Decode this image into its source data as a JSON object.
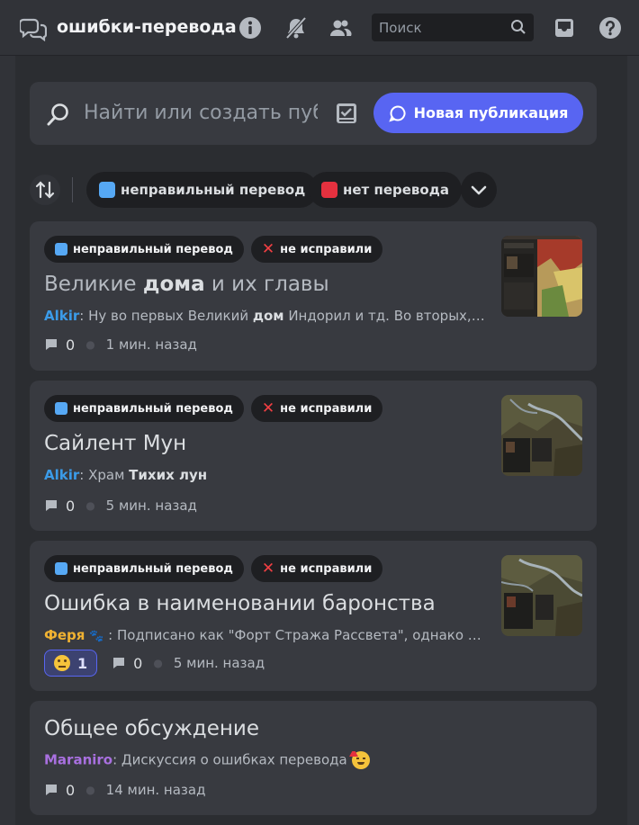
{
  "header": {
    "channel_name": "ошибки-перевода",
    "search_placeholder": "Поиск"
  },
  "create_bar": {
    "input_placeholder": "Найти или создать пуб",
    "new_post_label": "Новая публикация"
  },
  "filters": {
    "tags": [
      {
        "label": "неправильный перевод",
        "color": "#56a8f4"
      },
      {
        "label": "нет перевода",
        "color": "#e5313f"
      }
    ]
  },
  "colors": {
    "accent": "#5865f2",
    "tag_blue": "#56a8f4",
    "tag_red": "#e5313f",
    "author_blue": "#3b9be8",
    "author_gold": "#f0b232",
    "author_purple": "#a970e0"
  },
  "posts": [
    {
      "tag1": "неправильный перевод",
      "tag2": "не исправили",
      "title_pre": "Великие ",
      "title_bold": "дома",
      "title_post": " и их главы",
      "author": "Alkir",
      "preview_pre": "Ну во первых Великий ",
      "preview_bold": "дом",
      "preview_post": " Индорил и тд. Во вторых, я не",
      "comments": "0",
      "time": "1 мин. назад"
    },
    {
      "tag1": "неправильный перевод",
      "tag2": "не исправили",
      "title": "Сайлент Мун",
      "author": "Alkir",
      "preview_pre": "Храм ",
      "preview_bold": "Тихих лун",
      "comments": "0",
      "time": "5 мин. назад"
    },
    {
      "tag1": "неправильный перевод",
      "tag2": "не исправили",
      "title": "Ошибка в наименовании баронства",
      "author": "Феря",
      "preview": "Подписано как \"Форт Стража Рассвета\", однако фо",
      "reaction_count": "1",
      "comments": "0",
      "time": "5 мин. назад"
    },
    {
      "title": "Общее обсуждение",
      "author": "Maraniro",
      "preview": "Дискуссия о ошибках перевода",
      "comments": "0",
      "time": "14 мин. назад"
    }
  ]
}
